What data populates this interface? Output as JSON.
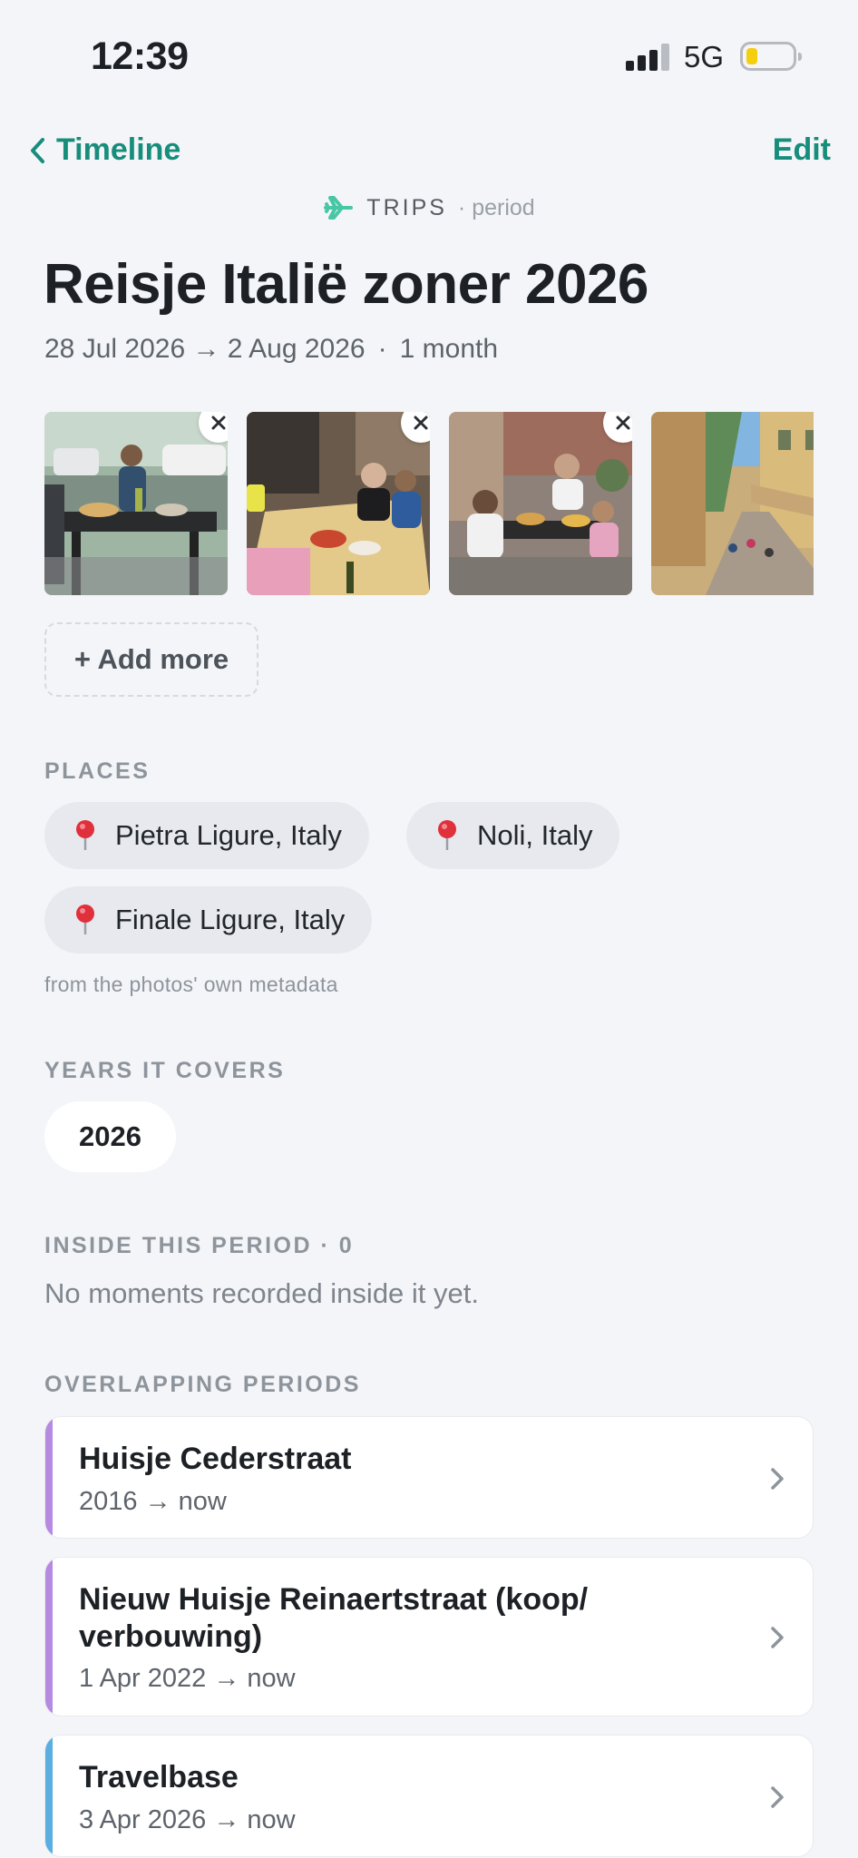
{
  "status_bar": {
    "time": "12:39",
    "network": "5G"
  },
  "nav": {
    "back_label": "Timeline",
    "edit_label": "Edit"
  },
  "category": {
    "label": "TRIPS",
    "suffix": "· period"
  },
  "title": "Reisje Italië zoner 2026",
  "subtitle": {
    "range": "28 Jul 2026 → 2 Aug 2026",
    "separator": "·",
    "duration": "1 month"
  },
  "add_more_label": "+ Add more",
  "places": {
    "label": "PLACES",
    "items": [
      "Pietra Ligure, Italy",
      "Noli, Italy",
      "Finale Ligure, Italy"
    ],
    "note": "from the photos' own metadata"
  },
  "years": {
    "label": "YEARS IT COVERS",
    "items": [
      "2026"
    ]
  },
  "inside": {
    "label": "INSIDE THIS PERIOD · 0",
    "empty_text": "No moments recorded inside it yet."
  },
  "overlapping": {
    "label": "OVERLAPPING PERIODS",
    "items": [
      {
        "title": "Huisje Cederstraat",
        "range": "2016 → now",
        "color": "#b58ae0"
      },
      {
        "title_line1": "Nieuw Huisje Reinaertstraat (koop/",
        "title_line2": "verbouwing)",
        "range": "1 Apr 2022 → now",
        "color": "#b58ae0"
      },
      {
        "title": "Travelbase",
        "range": "3 Apr 2026 → now",
        "color": "#5aaee0"
      }
    ]
  },
  "colors": {
    "accent": "#178d7b",
    "plane_icon": "#47c7a5",
    "pin": "#e0303b"
  }
}
